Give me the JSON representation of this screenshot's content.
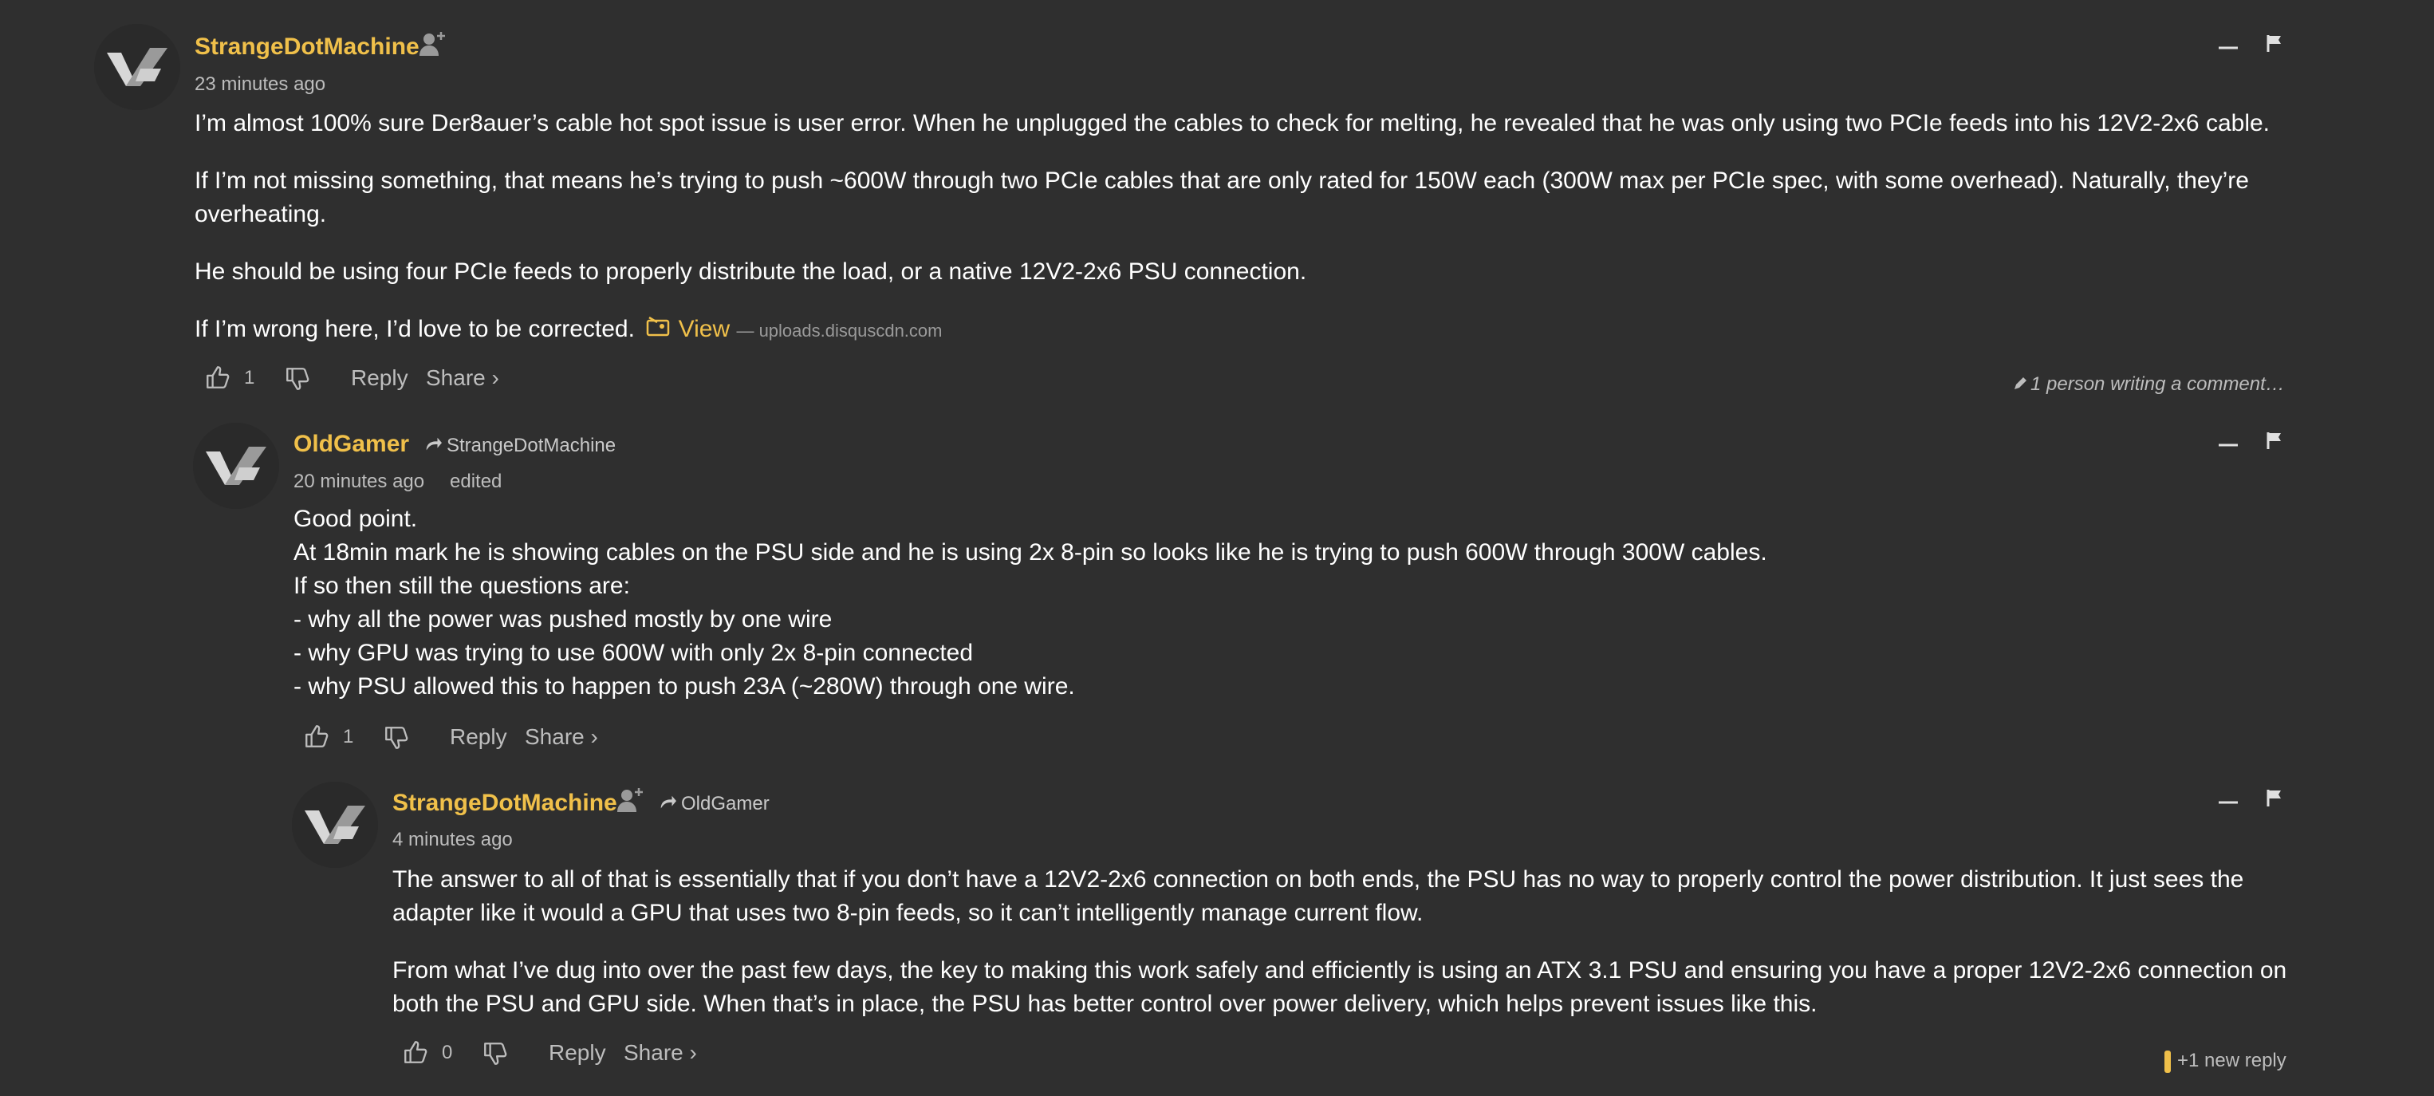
{
  "comments": [
    {
      "author": "StrangeDotMachine",
      "timestamp": "23 minutes ago",
      "paragraphs": [
        "I’m almost 100% sure Der8auer’s cable hot spot issue is user error. When he unplugged the cables to check for melting, he revealed that he was only using two PCIe feeds into his 12V2-2x6 cable.",
        "If I’m not missing something, that means he’s trying to push ~600W through two PCIe cables that are only rated for 150W each (300W max per PCIe spec, with some overhead). Naturally, they’re",
        "overheating.",
        "He should be using four PCIe feeds to properly distribute the load, or a native 12V2-2x6 PSU connection.",
        "If I’m wrong here, I’d love to be corrected."
      ],
      "view_link": "View",
      "view_domain": "— uploads.disquscdn.com",
      "likes": "1",
      "reply_label": "Reply",
      "share_label": "Share ›",
      "writing_indicator": "1 person writing a comment…"
    },
    {
      "author": "OldGamer",
      "reply_to": "StrangeDotMachine",
      "timestamp": "20 minutes ago",
      "edited": "edited",
      "lines": [
        "Good point.",
        "At 18min mark he is showing cables on the PSU side and he is using 2x 8-pin so looks like he is trying to push 600W through 300W cables.",
        "If so then still the questions are:",
        "- why all the power was pushed mostly by one wire",
        "- why GPU was trying to use 600W with only 2x 8-pin connected",
        "- why PSU allowed this to happen to push 23A (~280W) through one wire."
      ],
      "likes": "1",
      "reply_label": "Reply",
      "share_label": "Share ›"
    },
    {
      "author": "StrangeDotMachine",
      "reply_to": "OldGamer",
      "timestamp": "4 minutes ago",
      "paragraphs": [
        "The answer to all of that is essentially that if you don’t have a 12V2-2x6 connection on both ends, the PSU has no way to properly control the power distribution. It just sees the",
        "adapter like it would a GPU that uses two 8-pin feeds, so it can’t intelligently manage current flow.",
        "From what I’ve dug into over the past few days, the key to making this work safely and efficiently is using an ATX 3.1 PSU and ensuring you have a proper 12V2-2x6 connection on",
        "both the PSU and GPU side. When that’s in place, the PSU has better control over power delivery, which helps prevent issues like this."
      ],
      "likes": "0",
      "reply_label": "Reply",
      "share_label": "Share ›",
      "new_reply": "+1 new reply"
    }
  ],
  "colors": {
    "background": "#2f2f2f",
    "author": "#f0c04a",
    "text": "#ffffff",
    "muted": "#bdbdbd"
  },
  "icons": [
    "avatar-logo",
    "follow-icon",
    "reply-arrow-icon",
    "collapse-icon",
    "flag-icon",
    "thumbs-up-icon",
    "thumbs-down-icon",
    "image-icon",
    "pencil-icon"
  ]
}
